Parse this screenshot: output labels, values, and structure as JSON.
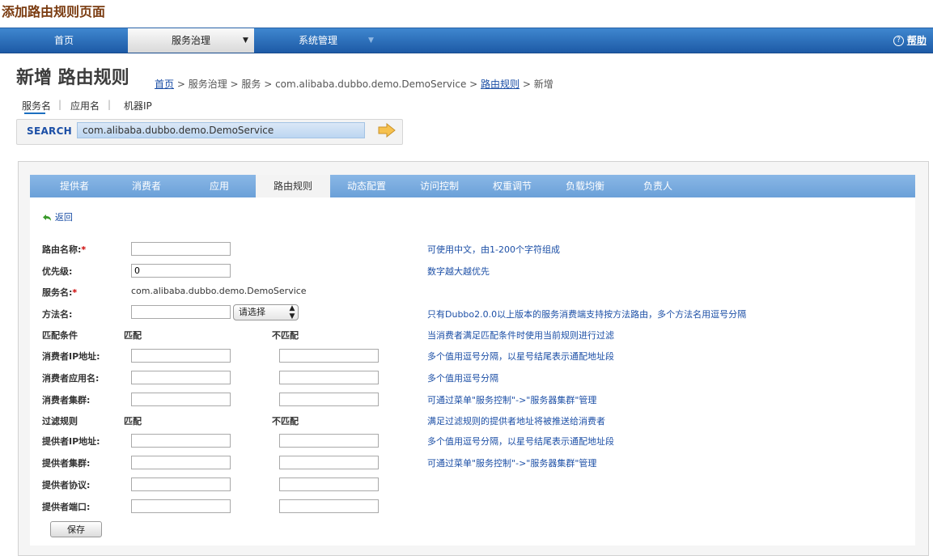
{
  "doc_title": "添加路由规则页面",
  "nav": {
    "items": [
      {
        "label": "首页"
      },
      {
        "label": "服务治理",
        "caret": "▼"
      },
      {
        "label": "系统管理",
        "caret": "▼"
      }
    ],
    "help_icon": "?",
    "help_label": "帮助"
  },
  "page": {
    "heading": "新增 路由规则",
    "breadcrumb": {
      "home": "首页",
      "middle": " > 服务治理 > 服务 > com.alibaba.dubbo.demo.DemoService > ",
      "route": "路由规则",
      "tail": " > 新增"
    }
  },
  "search_tabs": [
    "服务名",
    "应用名",
    "机器IP"
  ],
  "search_tab_separator": "|",
  "search": {
    "label": "SEARCH",
    "value": "com.alibaba.dubbo.demo.DemoService"
  },
  "service_tabs": [
    "提供者",
    "消费者",
    "应用",
    "路由规则",
    "动态配置",
    "访问控制",
    "权重调节",
    "负载均衡",
    "负责人"
  ],
  "back_label": "返回",
  "form": {
    "required_mark": "*",
    "name_label": "路由名称:",
    "name_hint": "可使用中文，由1-200个字符组成",
    "priority_label": "优先级:",
    "priority_value": "0",
    "priority_hint": "数字越大越优先",
    "service_label": "服务名:",
    "service_value": "com.alibaba.dubbo.demo.DemoService",
    "method_label": "方法名:",
    "method_select": "请选择",
    "method_select_arrows": "▲▼",
    "method_hint": "只有Dubbo2.0.0以上版本的服务消费端支持按方法路由，多个方法名用逗号分隔",
    "match_section": {
      "label": "匹配条件",
      "match": "匹配",
      "mismatch": "不匹配",
      "hint": "当消费者满足匹配条件时使用当前规则进行过滤"
    },
    "consumer_ip": {
      "label": "消费者IP地址:",
      "hint": "多个值用逗号分隔，以星号结尾表示通配地址段"
    },
    "consumer_app": {
      "label": "消费者应用名:",
      "hint": "多个值用逗号分隔"
    },
    "consumer_cluster": {
      "label": "消费者集群:",
      "hint": "可通过菜单\"服务控制\"->\"服务器集群\"管理"
    },
    "filter_section": {
      "label": "过滤规则",
      "match": "匹配",
      "mismatch": "不匹配",
      "hint": "满足过滤规则的提供者地址将被推送给消费者"
    },
    "provider_ip": {
      "label": "提供者IP地址:",
      "hint": "多个值用逗号分隔，以星号结尾表示通配地址段"
    },
    "provider_cluster": {
      "label": "提供者集群:",
      "hint": "可通过菜单\"服务控制\"->\"服务器集群\"管理"
    },
    "provider_protocol": {
      "label": "提供者协议:"
    },
    "provider_port": {
      "label": "提供者端口:"
    },
    "save_label": "保存"
  },
  "colors": {
    "nav": "#2467b3",
    "tabs": "#7eaee0",
    "link": "#1c4fa6",
    "required": "#cc0000",
    "doc_title": "#7a3b10"
  }
}
